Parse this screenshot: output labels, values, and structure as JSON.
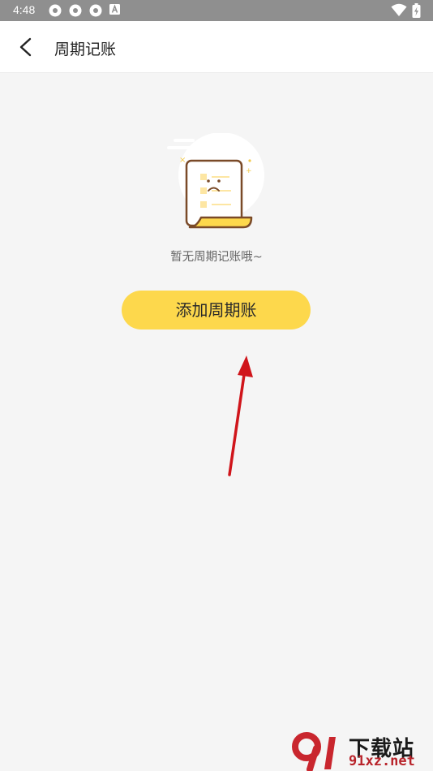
{
  "status_bar": {
    "time": "4:48",
    "icons": [
      "settings-gear-icon",
      "settings-gear-icon",
      "settings-gear-icon",
      "font-a-icon",
      "wifi-icon",
      "battery-charging-icon"
    ]
  },
  "header": {
    "back_icon": "chevron-left-icon",
    "title": "周期记账"
  },
  "empty_state": {
    "illustration": "empty-ledger-illustration",
    "message": "暂无周期记账哦~"
  },
  "actions": {
    "add_label": "添加周期账"
  },
  "annotation": {
    "arrow_color": "#d0151b"
  },
  "watermark": {
    "title": "下载站",
    "url": "91xz.net"
  },
  "colors": {
    "accent": "#fdd84c",
    "background": "#f5f5f5",
    "status_bar": "#8f8f8f"
  }
}
